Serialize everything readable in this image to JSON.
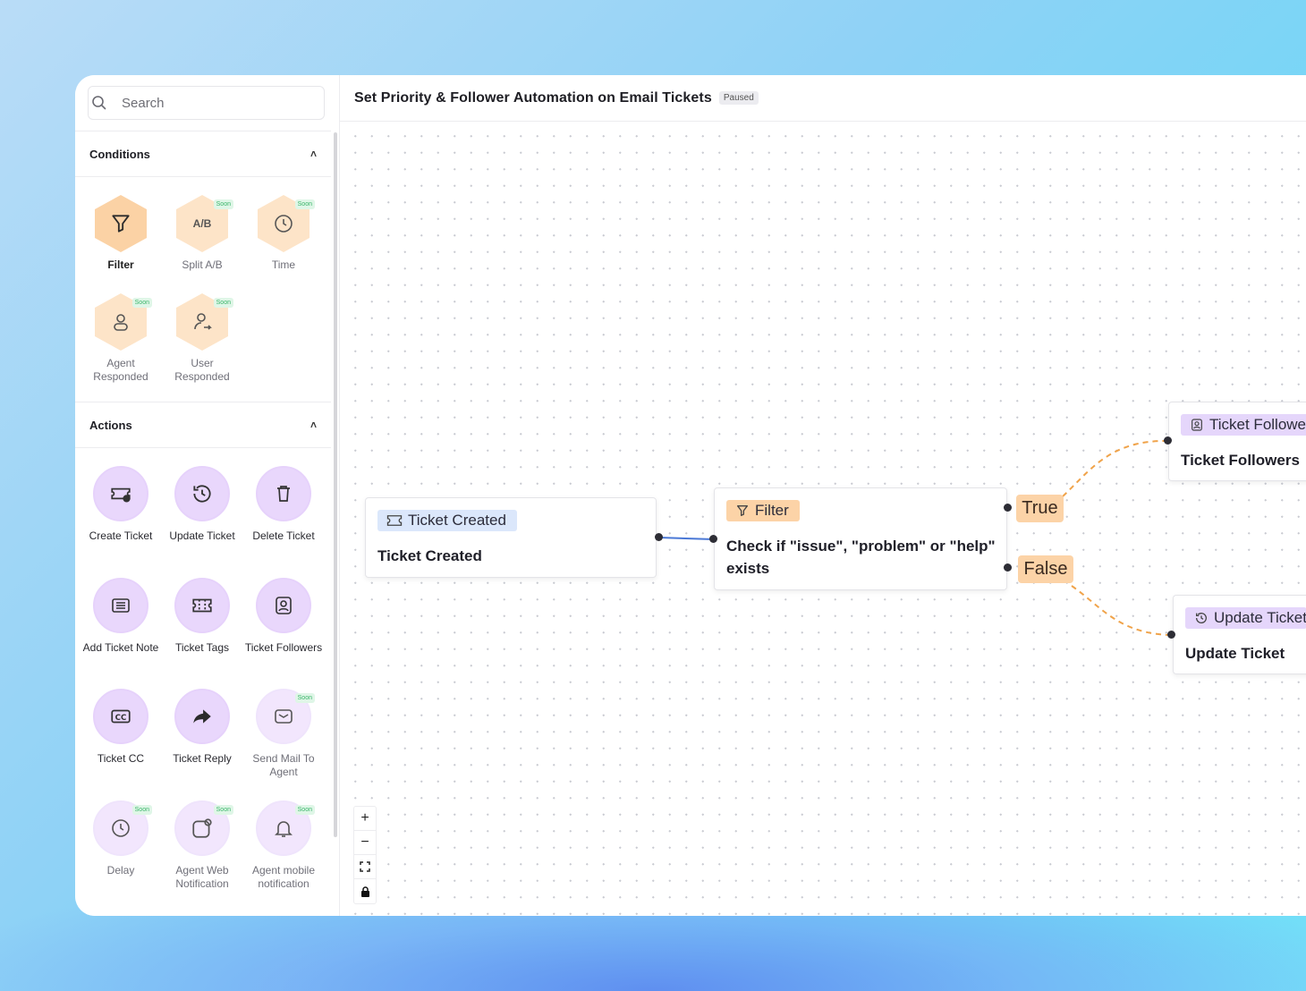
{
  "search": {
    "placeholder": "Search"
  },
  "conditions": {
    "header": "Conditions",
    "items": [
      {
        "label": "Filter",
        "icon": "funnel-icon",
        "soon": false
      },
      {
        "label": "Split A/B",
        "icon": "ab-split-icon",
        "soon": true,
        "soon_label": "Soon",
        "icon_text": "A/B"
      },
      {
        "label": "Time",
        "icon": "clock-icon",
        "soon": true,
        "soon_label": "Soon"
      },
      {
        "label": "Agent Responded",
        "icon": "agent-icon",
        "soon": true,
        "soon_label": "Soon"
      },
      {
        "label": "User Responded",
        "icon": "user-reply-icon",
        "soon": true,
        "soon_label": "Soon"
      }
    ]
  },
  "actions": {
    "header": "Actions",
    "items": [
      {
        "label": "Create Ticket",
        "icon": "ticket-plus-icon"
      },
      {
        "label": "Update Ticket",
        "icon": "history-icon"
      },
      {
        "label": "Delete Ticket",
        "icon": "trash-icon"
      },
      {
        "label": "Add Ticket Note",
        "icon": "note-icon"
      },
      {
        "label": "Ticket Tags",
        "icon": "ticket-icon"
      },
      {
        "label": "Ticket Followers",
        "icon": "follower-icon"
      },
      {
        "label": "Ticket CC",
        "icon": "cc-icon"
      },
      {
        "label": "Ticket Reply",
        "icon": "reply-arrow-icon"
      },
      {
        "label": "Send Mail To Agent",
        "icon": "mail-icon",
        "soon_label": "Soon"
      },
      {
        "label": "Delay",
        "icon": "clock-icon",
        "soon_label": "Soon"
      },
      {
        "label": "Agent Web Notification",
        "icon": "notification-icon",
        "soon_label": "Soon"
      },
      {
        "label": "Agent mobile notification",
        "icon": "bell-icon",
        "soon_label": "Soon"
      }
    ]
  },
  "workflow": {
    "title": "Set Priority & Follower Automation on Email Tickets",
    "status": "Paused"
  },
  "nodes": {
    "trigger": {
      "tag": "Ticket Created",
      "body": "Ticket Created"
    },
    "filter": {
      "tag": "Filter",
      "body_line1": "Check if \"issue\", \"problem\" or \"help\"",
      "body_line2": "exists"
    },
    "followers": {
      "tag": "Ticket Followers",
      "body": "Ticket Followers"
    },
    "update": {
      "tag": "Update Ticket",
      "body": "Update Ticket"
    }
  },
  "branches": {
    "true_label": "True",
    "false_label": "False"
  },
  "controls": {
    "zoom_in": "+",
    "zoom_out": "−"
  },
  "colors": {
    "accent_orange": "#fcd3a7",
    "accent_purple": "#e5d6fb",
    "accent_blue": "#dbe7fb",
    "edge_blue": "#4a78d6",
    "edge_orange": "#f0a34a"
  }
}
